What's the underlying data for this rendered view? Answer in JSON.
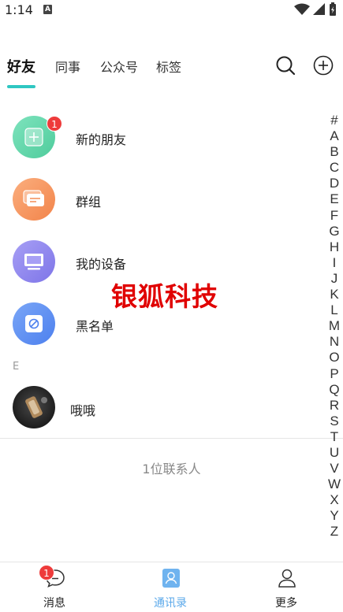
{
  "status_bar": {
    "time": "1:14",
    "notification_icon": "A"
  },
  "tabs": [
    {
      "label": "好友",
      "active": true
    },
    {
      "label": "同事",
      "active": false
    },
    {
      "label": "公众号",
      "active": false
    },
    {
      "label": "标签",
      "active": false
    }
  ],
  "header_icons": [
    "search-icon",
    "add-circle-icon"
  ],
  "list": {
    "new_friends": {
      "label": "新的朋友",
      "badge": "1",
      "icon": "plus-icon",
      "color": "#5ed4a8"
    },
    "groups": {
      "label": "群组",
      "icon": "chat-bubble-icon",
      "color": "#f7945c"
    },
    "devices": {
      "label": "我的设备",
      "icon": "monitor-icon",
      "color": "#8f86ee"
    },
    "blacklist": {
      "label": "黑名单",
      "icon": "block-icon",
      "color": "#5d8ff2"
    }
  },
  "watermark": "银狐科技",
  "section": {
    "letter": "E"
  },
  "contacts": [
    {
      "name": "哦哦"
    }
  ],
  "contact_count": "1位联系人",
  "alphabet_index": [
    "#",
    "A",
    "B",
    "C",
    "D",
    "E",
    "F",
    "G",
    "H",
    "I",
    "J",
    "K",
    "L",
    "M",
    "N",
    "O",
    "P",
    "Q",
    "R",
    "S",
    "T",
    "U",
    "V",
    "W",
    "X",
    "Y",
    "Z"
  ],
  "bottom_nav": {
    "messages": {
      "label": "消息",
      "badge": "1"
    },
    "contacts": {
      "label": "通讯录",
      "active": true
    },
    "more": {
      "label": "更多"
    }
  },
  "colors": {
    "accent": "#2fc7c2",
    "nav_active": "#5aa8ea",
    "badge": "#ee3b3b",
    "watermark": "#e00000"
  }
}
